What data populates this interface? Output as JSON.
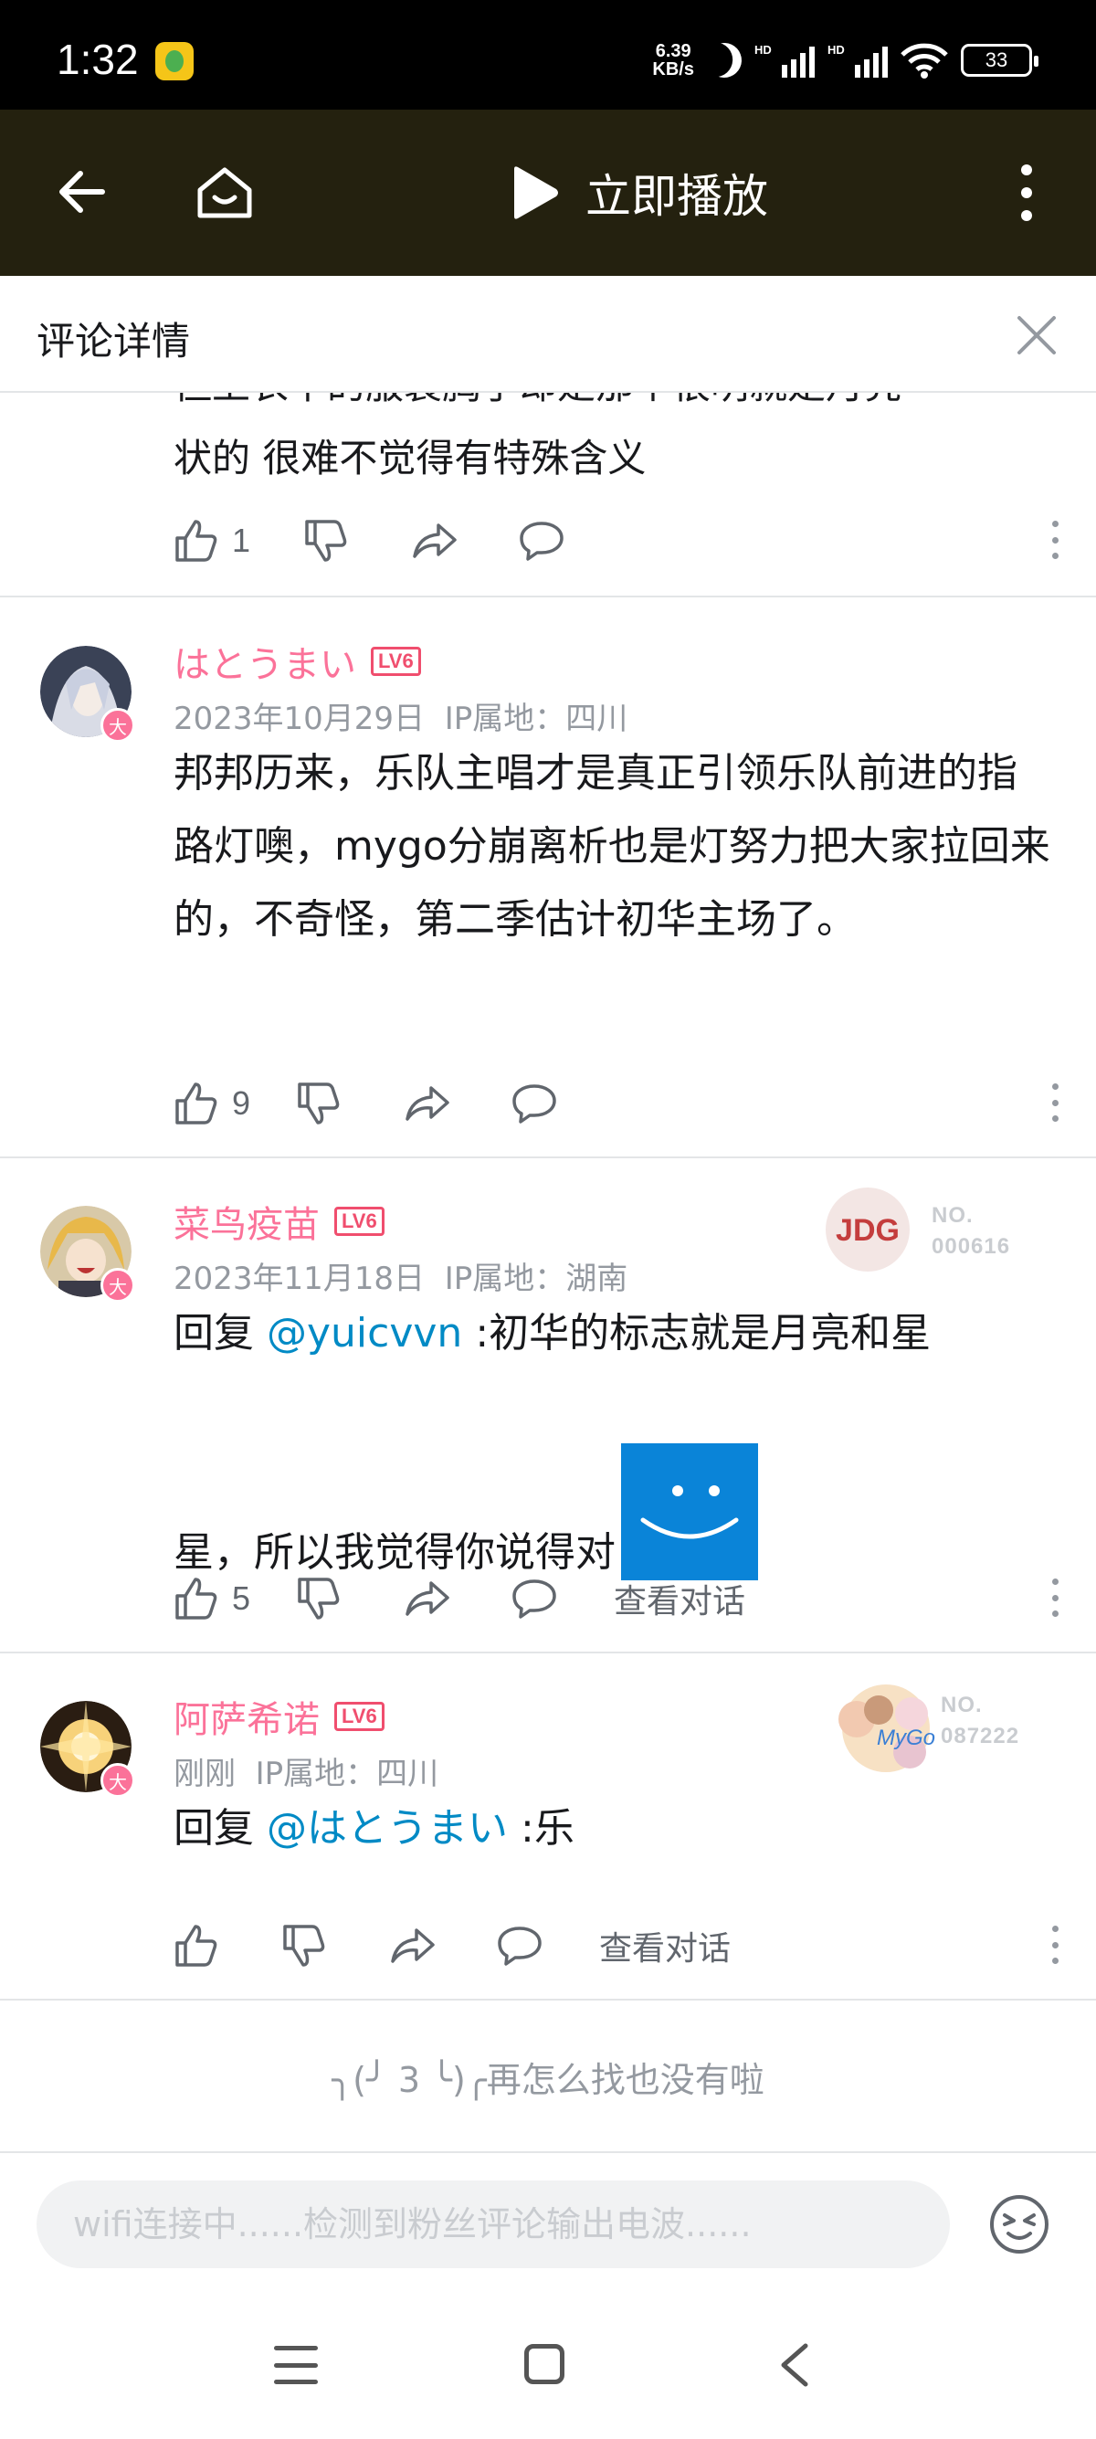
{
  "status_bar": {
    "time": "1:32",
    "net_speed_value": "6.39",
    "net_speed_unit": "KB/s",
    "signal_label_1": "HD",
    "signal_label_2": "HD",
    "battery": "33",
    "icons": [
      "app-notification-icon",
      "moon-icon",
      "signal-icon",
      "signal-icon",
      "wifi-icon",
      "battery-icon"
    ]
  },
  "app_bar": {
    "back_icon": "arrow-left-icon",
    "home_icon": "home-icon",
    "play_label": "立即播放",
    "more_icon": "more-vertical-icon",
    "background": "#24210f"
  },
  "panel": {
    "title": "评论详情",
    "close_icon": "close-icon"
  },
  "partial_comment": {
    "text_cut": "但上衣中的服装胸手却是那个很明就是月亮",
    "text_last_line": "状的 很难不觉得有特殊含义",
    "like_count": "1"
  },
  "comments": [
    {
      "username": "はとうまい",
      "level": "LV6",
      "badge": "大",
      "date": "2023年10月29日",
      "ip": "IP属地：四川",
      "text": "邦邦历来，乐队主唱才是真正引领乐队前进的指路灯噢，mygo分崩离析也是灯努力把大家拉回来的，不奇怪，第二季估计初华主场了。",
      "like_count": "9"
    },
    {
      "username": "菜鸟疫苗",
      "level": "LV6",
      "badge": "大",
      "date": "2023年11月18日",
      "ip": "IP属地：湖南",
      "fan_label": "NO.",
      "fan_number": "000616",
      "reply_prefix": "回复",
      "mention": "@yuicvvn",
      "text_line1": ":初华的标志就是月亮和星",
      "text_line2": "星，所以我觉得你说得对",
      "sticker": "smile-face-emoji",
      "like_count": "5",
      "view_conversation": "查看对话"
    },
    {
      "username": "阿萨希诺",
      "level": "LV6",
      "badge": "大",
      "date": "刚刚",
      "ip": "IP属地：四川",
      "fan_label": "NO.",
      "fan_number": "087222",
      "reply_prefix": "回复",
      "mention": "@はとうまい",
      "text": ":乐",
      "view_conversation": "查看对话"
    }
  ],
  "end_tip": "╮(╯ 3 ╰)╭再怎么找也没有啦",
  "input": {
    "placeholder": "wifi连接中......检测到粉丝评论输出电波......",
    "emoji_icon": "emoji-face-icon"
  },
  "accent_colors": {
    "username_pink": "#fb7299",
    "mention_blue": "#008ac5",
    "level_red": "#f04e6e",
    "sticker_blue": "#0a84d8"
  }
}
